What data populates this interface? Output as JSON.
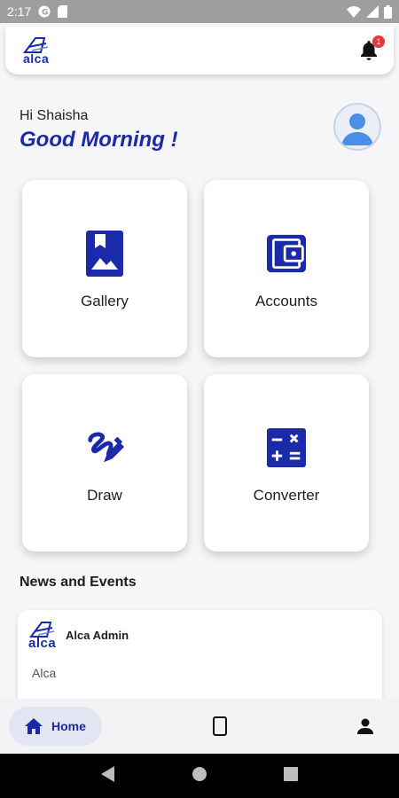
{
  "status_bar": {
    "time": "2:17"
  },
  "app_bar": {
    "logo_text": "alca",
    "notification_count": "1"
  },
  "greeting": {
    "name_line": "Hi Shaisha",
    "main_line": "Good Morning !"
  },
  "tiles": [
    {
      "label": "Gallery",
      "icon": "gallery-icon"
    },
    {
      "label": "Accounts",
      "icon": "wallet-icon"
    },
    {
      "label": "Draw",
      "icon": "draw-icon"
    },
    {
      "label": "Converter",
      "icon": "calculator-icon"
    }
  ],
  "news": {
    "section_title": "News and Events",
    "items": [
      {
        "logo_text": "alca",
        "author": "Alca Admin",
        "body": "Alca"
      }
    ]
  },
  "bottom_nav": {
    "home_label": "Home",
    "items": [
      "home-icon",
      "phone-icon",
      "person-icon"
    ]
  },
  "colors": {
    "brand": "#1a2aa8",
    "accent_avatar": "#4a8fe7",
    "badge": "#e53935"
  }
}
